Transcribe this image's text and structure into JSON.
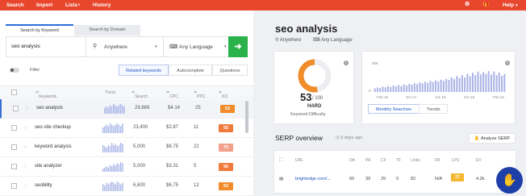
{
  "topbar": {
    "nav": [
      "Search",
      "Import",
      "Lists",
      "History"
    ],
    "lists_badge": "0",
    "settings_icon": "gear-icon",
    "gift_icon": "gift-icon",
    "help_label": "Help"
  },
  "search": {
    "tab_keyword": "Search by Keyword",
    "tab_domain": "Search by Domain",
    "keyword_value": "seo analysis",
    "location": "Anywhere",
    "language": "Any Language",
    "go_icon": "arrow-right-icon"
  },
  "filter": {
    "label": "Filter",
    "segments": [
      "Related keywords",
      "Autocomplete",
      "Questions"
    ],
    "active_segment": "Related keywords"
  },
  "table": {
    "headers": {
      "keywords": "Keywords",
      "trend": "Trend",
      "search": "Search",
      "cpc": "CPC",
      "ppc": "PPC",
      "kd": "KD"
    },
    "rows": [
      {
        "keyword": "seo analysis",
        "search": "29,669",
        "cpc": "$4.14",
        "ppc": "25",
        "kd": "53",
        "kd_color": "#f08c2a",
        "trend": [
          5,
          6,
          5,
          7,
          6,
          8,
          7,
          6,
          7,
          8,
          7,
          6
        ]
      },
      {
        "keyword": "seo site checkup",
        "search": "23,400",
        "cpc": "$2.87",
        "ppc": "11",
        "kd": "55",
        "kd_color": "#ef7a3c",
        "trend": [
          4,
          5,
          6,
          5,
          7,
          6,
          5,
          6,
          7,
          6,
          5,
          7
        ]
      },
      {
        "keyword": "keyword analysis",
        "search": "5,000",
        "cpc": "$6.75",
        "ppc": "22",
        "kd": "70",
        "kd_color": "#f2a08c",
        "trend": [
          6,
          5,
          4,
          6,
          5,
          8,
          6,
          7,
          5,
          6,
          8,
          7
        ]
      },
      {
        "keyword": "site analyzer",
        "search": "5,000",
        "cpc": "$3.31",
        "ppc": "5",
        "kd": "56",
        "kd_color": "#ef7a3c",
        "trend": [
          3,
          4,
          5,
          4,
          6,
          5,
          7,
          6,
          8,
          7,
          9,
          8
        ]
      },
      {
        "keyword": "seobility",
        "search": "6,600",
        "cpc": "$6.75",
        "ppc": "12",
        "kd": "52",
        "kd_color": "#f08c2a",
        "trend": [
          5,
          4,
          6,
          5,
          6,
          7,
          6,
          5,
          7,
          6,
          5,
          6
        ]
      }
    ]
  },
  "detail": {
    "keyword": "seo analysis",
    "location": "Anywhere",
    "language": "Any Language",
    "kd_value": "53",
    "kd_max": "/ 100",
    "kd_label": "HARD",
    "kd_sublabel": "Keyword Difficulty",
    "kd_fraction": 0.53,
    "volume_axis_top": "50K",
    "volume_axis_zero": "0",
    "volume_dates": [
      "Feb 15",
      "Oct 17",
      "Jun 19",
      "Oct 19",
      "Feb 22"
    ],
    "volume_bars": [
      0.12,
      0.15,
      0.13,
      0.18,
      0.16,
      0.2,
      0.17,
      0.22,
      0.19,
      0.24,
      0.2,
      0.26,
      0.22,
      0.28,
      0.25,
      0.3,
      0.27,
      0.33,
      0.29,
      0.35,
      0.31,
      0.38,
      0.34,
      0.4,
      0.36,
      0.42,
      0.38,
      0.45,
      0.41,
      0.5,
      0.44,
      0.55,
      0.48,
      0.58,
      0.5,
      0.62,
      0.54,
      0.66,
      0.58,
      0.7,
      0.6,
      0.68,
      0.62,
      0.72,
      0.6,
      0.7,
      0.58,
      0.66,
      0.55,
      0.62
    ],
    "btn_monthly": "Monthly Searches",
    "btn_trends": "Trends"
  },
  "serp": {
    "title": "SERP overview",
    "ago": "5 days ago",
    "analyze_label": "Analyze SERP",
    "headers": [
      "URL",
      "DA",
      "PA",
      "CF",
      "TF",
      "Links",
      "FB",
      "LPS",
      "EV"
    ],
    "row": {
      "url": "brightedge.com/...",
      "da": "60",
      "pa": "39",
      "cf": "29",
      "tf": "0",
      "links": "82",
      "fb": "N/A",
      "lps": "37",
      "ev": "4.2k"
    }
  },
  "colors": {
    "accent_red": "#e8472e",
    "go_green": "#2bb14a",
    "kd_orange": "#f08c2a",
    "link_blue": "#1f56c2"
  }
}
